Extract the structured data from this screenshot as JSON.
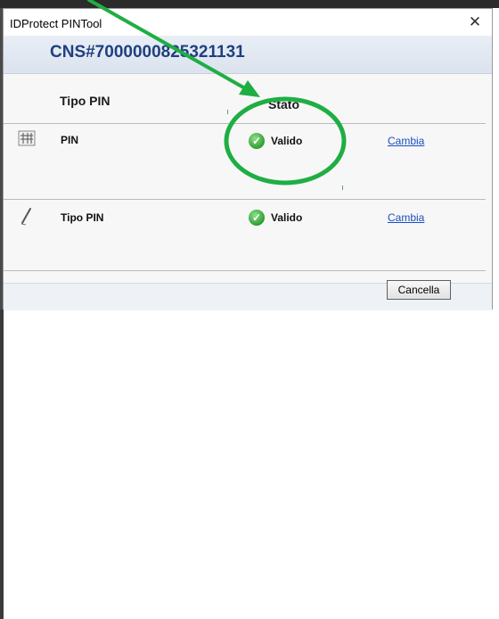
{
  "window": {
    "title": "IDProtect PINTool",
    "close_glyph": "✕"
  },
  "header": {
    "card_id": "CNS#7000000825321131"
  },
  "columns": {
    "type": "Tipo PIN",
    "status": "Stato"
  },
  "rows": [
    {
      "icon": "keypad-icon",
      "label": "PIN",
      "status": "Valido",
      "status_icon": "check-circle-icon",
      "action": "Cambia"
    },
    {
      "icon": "pen-icon",
      "label": "Tipo PIN",
      "status": "Valido",
      "status_icon": "check-circle-icon",
      "action": "Cambia"
    }
  ],
  "buttons": {
    "cancel": "Cancella"
  },
  "annotation": {
    "color": "#1fae44",
    "shapes": [
      "arrow",
      "ellipse"
    ]
  }
}
